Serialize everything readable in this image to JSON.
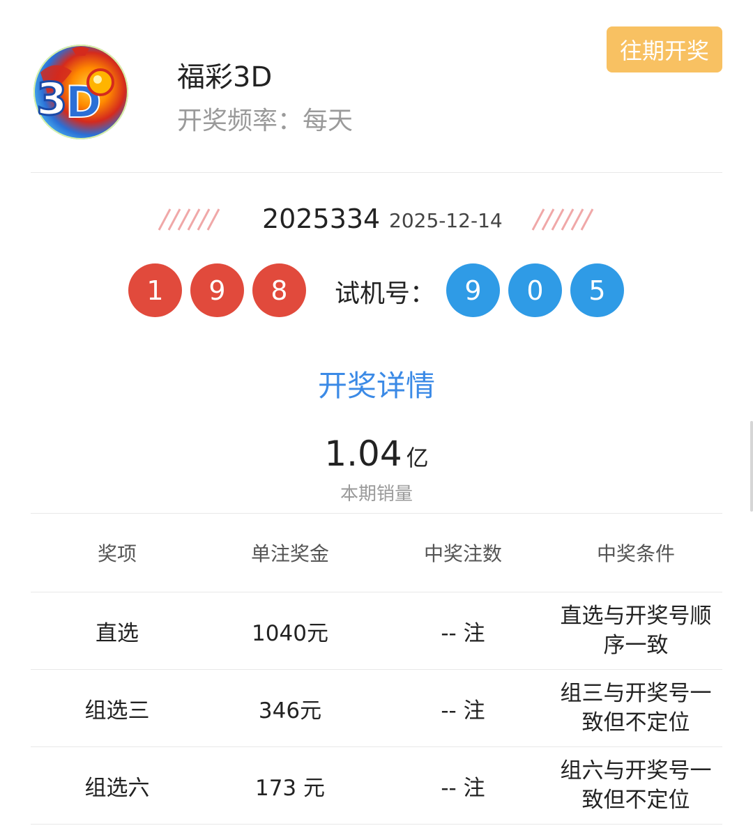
{
  "header": {
    "logo_icon": "fucai-3d-logo",
    "title": "福彩3D",
    "frequency": "开奖频率：每天",
    "history_button": "往期开奖",
    "history_button_color": "#f8c162"
  },
  "draw": {
    "issue": "2025334",
    "date": "2025-12-14",
    "winning_numbers": [
      "1",
      "9",
      "8"
    ],
    "trial_label": "试机号：",
    "trial_numbers": [
      "9",
      "0",
      "5"
    ],
    "winning_color": "#e14a3c",
    "trial_color": "#2f9be6"
  },
  "detail_link": "开奖详情",
  "sales": {
    "value": "1.04",
    "unit": "亿",
    "label": "本期销量"
  },
  "table": {
    "headers": [
      "奖项",
      "单注奖金",
      "中奖注数",
      "中奖条件"
    ],
    "rows": [
      {
        "name": "直选",
        "prize": "1040元",
        "count": "-- 注",
        "condition": "直选与开奖号顺序一致"
      },
      {
        "name": "组选三",
        "prize": "346元",
        "count": "-- 注",
        "condition": "组三与开奖号一致但不定位"
      },
      {
        "name": "组选六",
        "prize": "173 元",
        "count": "-- 注",
        "condition": "组六与开奖号一致但不定位"
      }
    ]
  }
}
